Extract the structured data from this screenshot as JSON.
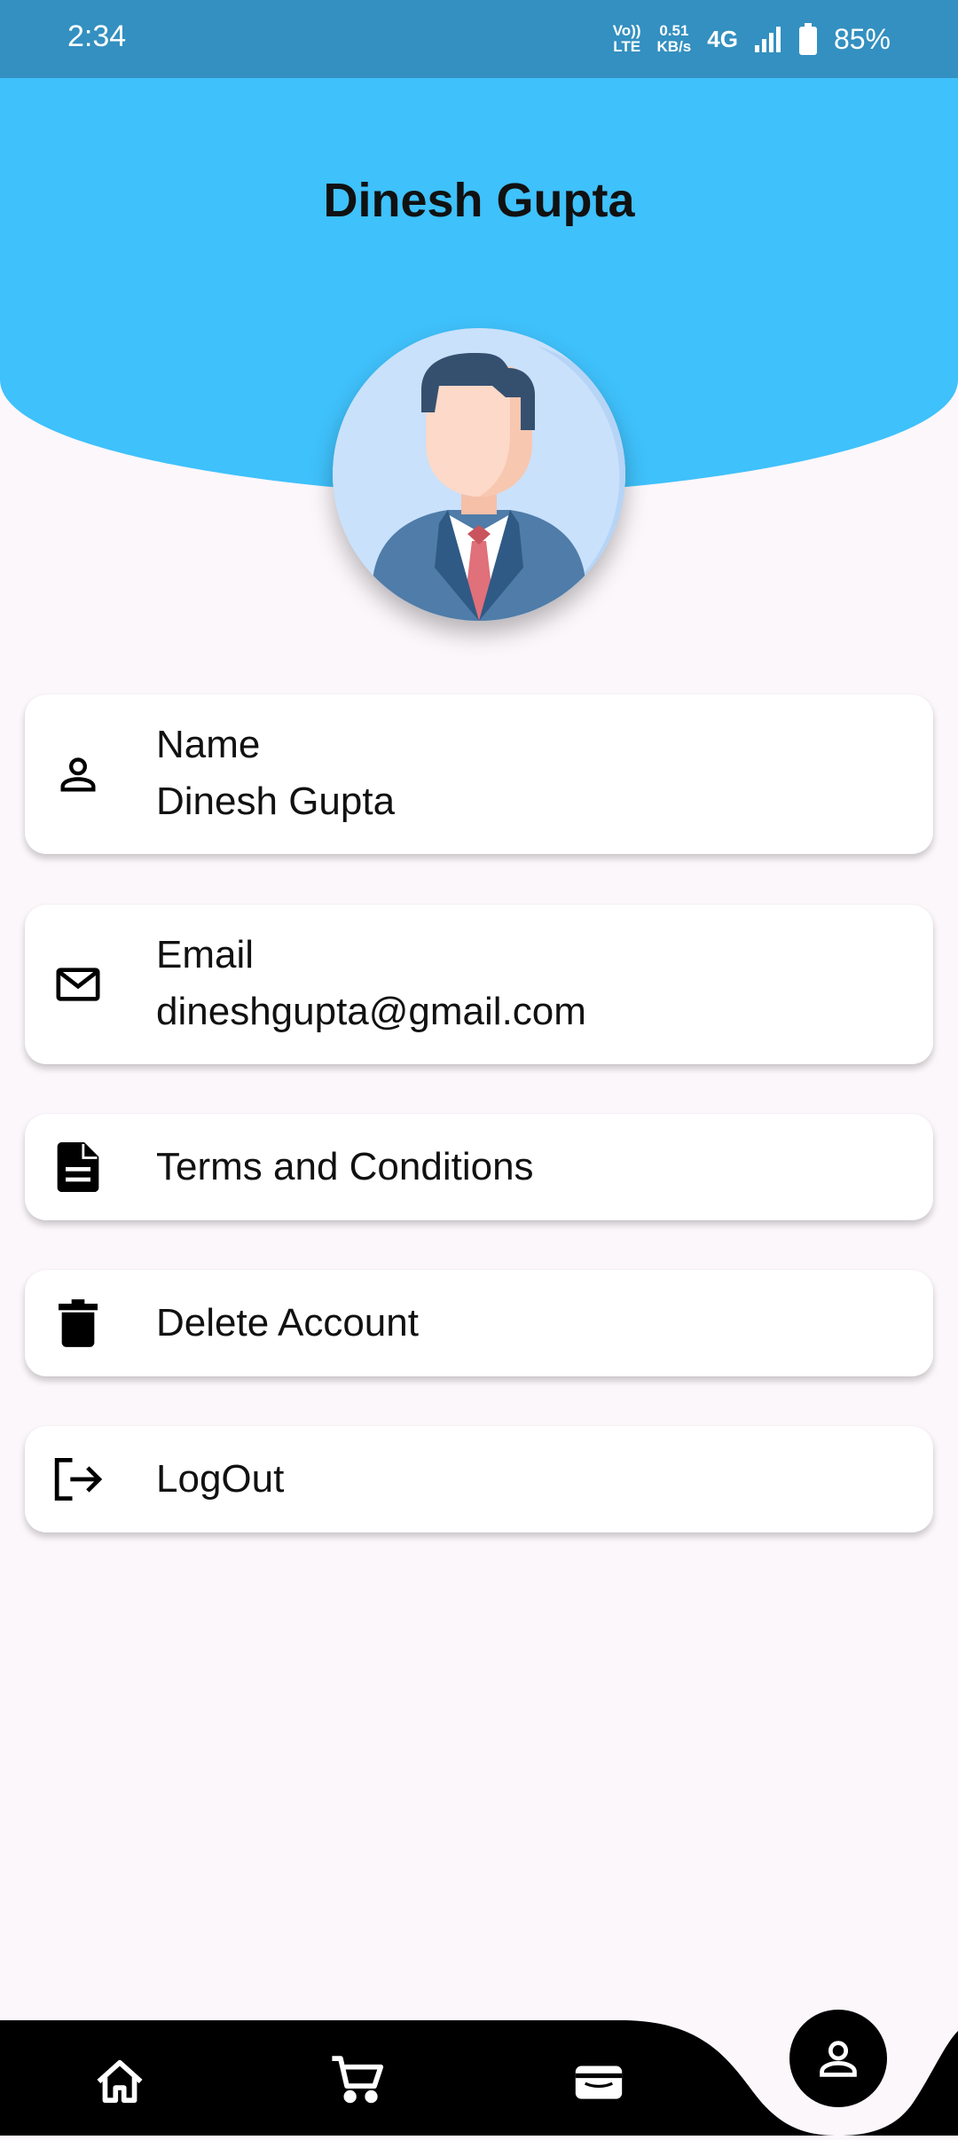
{
  "status_bar": {
    "time": "2:34",
    "volte_top": "Vo))",
    "volte_bottom": "LTE",
    "speed_value": "0.51",
    "speed_unit": "KB/s",
    "network": "4G",
    "battery": "85%"
  },
  "header": {
    "title": "Dinesh Gupta",
    "background_color": "#3fc1fb"
  },
  "profile_cards": [
    {
      "icon": "person-outline-icon",
      "label": "Name",
      "value": "Dinesh Gupta"
    },
    {
      "icon": "mail-outline-icon",
      "label": "Email",
      "value": "dineshgupta@gmail.com"
    },
    {
      "icon": "document-icon",
      "label": "Terms and Conditions"
    },
    {
      "icon": "trash-icon",
      "label": "Delete Account"
    },
    {
      "icon": "logout-icon",
      "label": "LogOut"
    }
  ],
  "bottom_nav": {
    "items": [
      "home-icon",
      "cart-icon",
      "wallet-icon",
      "profile-icon"
    ],
    "active": "profile-icon"
  }
}
